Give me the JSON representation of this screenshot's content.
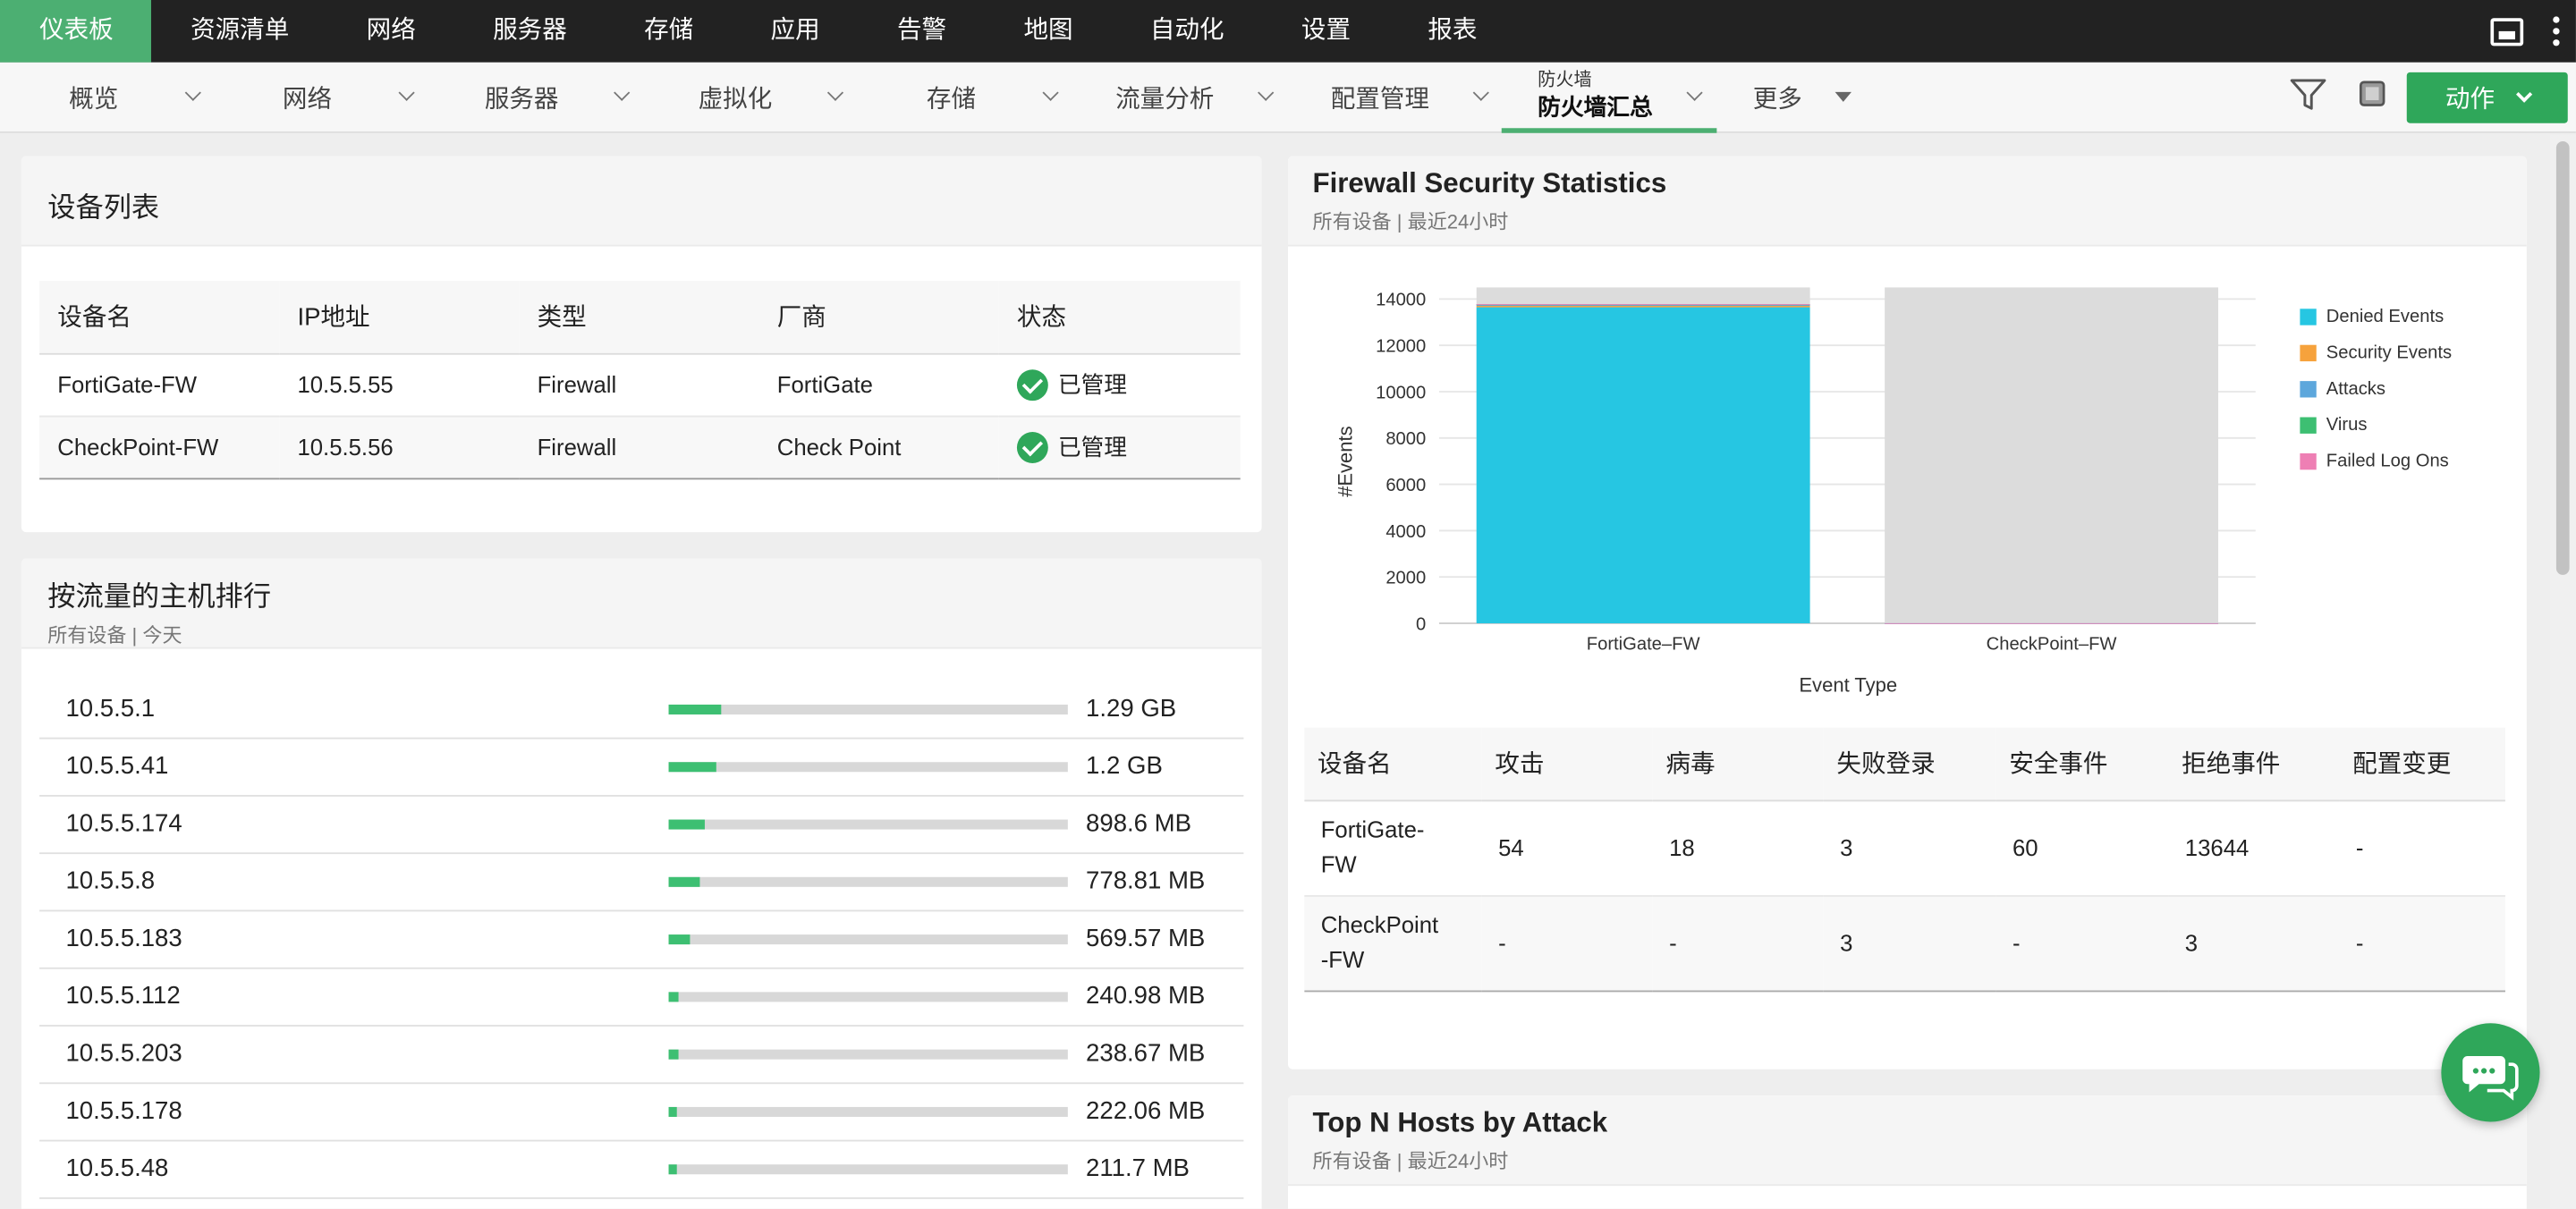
{
  "top_nav": {
    "items": [
      "仪表板",
      "资源清单",
      "网络",
      "服务器",
      "存储",
      "应用",
      "告警",
      "地图",
      "自动化",
      "设置",
      "报表"
    ],
    "active_index": 0
  },
  "sub_nav": {
    "tabs": [
      "概览",
      "网络",
      "服务器",
      "虚拟化",
      "存储",
      "流量分析",
      "配置管理"
    ],
    "active_tab": {
      "category": "防火墙",
      "label": "防火墙汇总"
    },
    "more_label": "更多",
    "action_label": "动作"
  },
  "device_list": {
    "title": "设备列表",
    "columns": [
      "设备名",
      "IP地址",
      "类型",
      "厂商",
      "状态"
    ],
    "rows": [
      [
        "FortiGate-FW",
        "10.5.5.55",
        "Firewall",
        "FortiGate",
        "已管理"
      ],
      [
        "CheckPoint-FW",
        "10.5.5.56",
        "Firewall",
        "Check Point",
        "已管理"
      ]
    ]
  },
  "top_hosts": {
    "title": "按流量的主机排行",
    "subtitle": "所有设备 | 今天",
    "rows": [
      {
        "ip": "10.5.5.1",
        "value": "1.29 GB",
        "fraction": 0.13
      },
      {
        "ip": "10.5.5.41",
        "value": "1.2 GB",
        "fraction": 0.12
      },
      {
        "ip": "10.5.5.174",
        "value": "898.6 MB",
        "fraction": 0.09
      },
      {
        "ip": "10.5.5.8",
        "value": "778.81 MB",
        "fraction": 0.08
      },
      {
        "ip": "10.5.5.183",
        "value": "569.57 MB",
        "fraction": 0.055
      },
      {
        "ip": "10.5.5.112",
        "value": "240.98 MB",
        "fraction": 0.025
      },
      {
        "ip": "10.5.5.203",
        "value": "238.67 MB",
        "fraction": 0.025
      },
      {
        "ip": "10.5.5.178",
        "value": "222.06 MB",
        "fraction": 0.022
      },
      {
        "ip": "10.5.5.48",
        "value": "211.7 MB",
        "fraction": 0.021
      }
    ]
  },
  "firewall_stats": {
    "title": "Firewall Security Statistics",
    "subtitle": "所有设备 | 最近24小时",
    "columns": [
      "设备名",
      "攻击",
      "病毒",
      "失败登录",
      "安全事件",
      "拒绝事件",
      "配置变更"
    ],
    "rows": [
      [
        "FortiGate-FW",
        "54",
        "18",
        "3",
        "60",
        "13644",
        "-"
      ],
      [
        "CheckPoint-FW",
        "-",
        "-",
        "3",
        "-",
        "3",
        "-"
      ]
    ]
  },
  "chart_data": {
    "type": "bar",
    "stacked": true,
    "categories": [
      "FortiGate–FW",
      "CheckPoint–FW"
    ],
    "xlabel": "Event Type",
    "ylabel": "#Events",
    "ylim": [
      0,
      14500
    ],
    "yticks": [
      0,
      2000,
      4000,
      6000,
      8000,
      10000,
      12000,
      14000
    ],
    "grid": true,
    "legend_position": "right",
    "series": [
      {
        "name": "Denied Events",
        "color": "#26c6e2",
        "values": [
          13644,
          3
        ]
      },
      {
        "name": "Security Events",
        "color": "#f6a23c",
        "values": [
          60,
          0
        ]
      },
      {
        "name": "Attacks",
        "color": "#5da7dc",
        "values": [
          54,
          0
        ]
      },
      {
        "name": "Virus",
        "color": "#3dbf72",
        "values": [
          18,
          0
        ]
      },
      {
        "name": "Failed Log Ons",
        "color": "#ee7fb4",
        "values": [
          3,
          3
        ]
      }
    ]
  },
  "top_attack": {
    "title": "Top N Hosts by Attack",
    "subtitle": "所有设备 | 最近24小时"
  }
}
